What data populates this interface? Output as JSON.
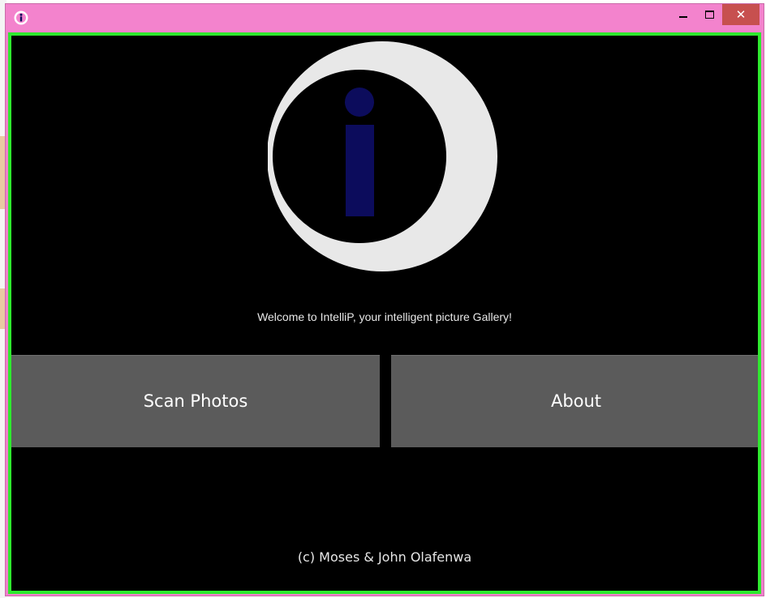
{
  "window": {
    "icon": "info-icon",
    "controls": {
      "minimize_icon": "minimize-icon",
      "maximize_icon": "maximize-icon",
      "close_label": "✕"
    }
  },
  "main": {
    "logo": "intellip-logo",
    "welcome_text": "Welcome to IntelliP, your intelligent picture Gallery!",
    "scan_button_label": "Scan Photos",
    "about_button_label": "About",
    "copyright_text": "(c) Moses & John Olafenwa"
  },
  "colors": {
    "titlebar": "#f383cd",
    "close_button": "#c7504f",
    "client_border": "#2ee92e",
    "background": "#000000",
    "button": "#5b5b5b",
    "logo_ring": "#e8e8e8",
    "logo_letter": "#0c0c5c"
  }
}
